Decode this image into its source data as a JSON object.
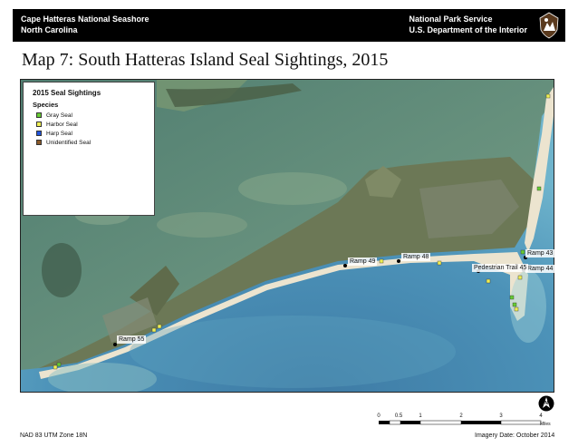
{
  "header": {
    "left_line1": "Cape Hatteras National Seashore",
    "left_line2": "North Carolina",
    "right_line1": "National Park Service",
    "right_line2": "U.S. Department of the Interior",
    "logo_icon": "nps-arrowhead-icon"
  },
  "title": "Map 7:  South Hatteras Island Seal Sightings, 2015",
  "legend": {
    "title": "2015 Seal Sightings",
    "subtitle": "Species",
    "items": [
      {
        "label": "Gray Seal",
        "color": "#66cc33"
      },
      {
        "label": "Harbor Seal",
        "color": "#eeee55"
      },
      {
        "label": "Harp Seal",
        "color": "#2255dd"
      },
      {
        "label": "Unidentified Seal",
        "color": "#8b5a2b"
      }
    ]
  },
  "places": [
    {
      "label": "Ramp 43"
    },
    {
      "label": "Ramp 44"
    },
    {
      "label": "Pedestrian Trail 45"
    },
    {
      "label": "Ramp 48"
    },
    {
      "label": "Ramp 49"
    },
    {
      "label": "Ramp 55"
    }
  ],
  "scale_bar": {
    "ticks": [
      "0",
      "0.5",
      "1",
      "2",
      "3",
      "4"
    ],
    "unit": "Miles"
  },
  "footer": {
    "projection": "NAD 83 UTM Zone 18N",
    "imagery_date": "Imagery Date:  October 2014"
  },
  "icons": {
    "north_arrow": "north-arrow-icon"
  },
  "colors": {
    "header_bg": "#000000",
    "ocean": "#3f86b0",
    "sound": "#5b8a7a",
    "land": "#6e7a58",
    "beach": "#eee7d2"
  }
}
